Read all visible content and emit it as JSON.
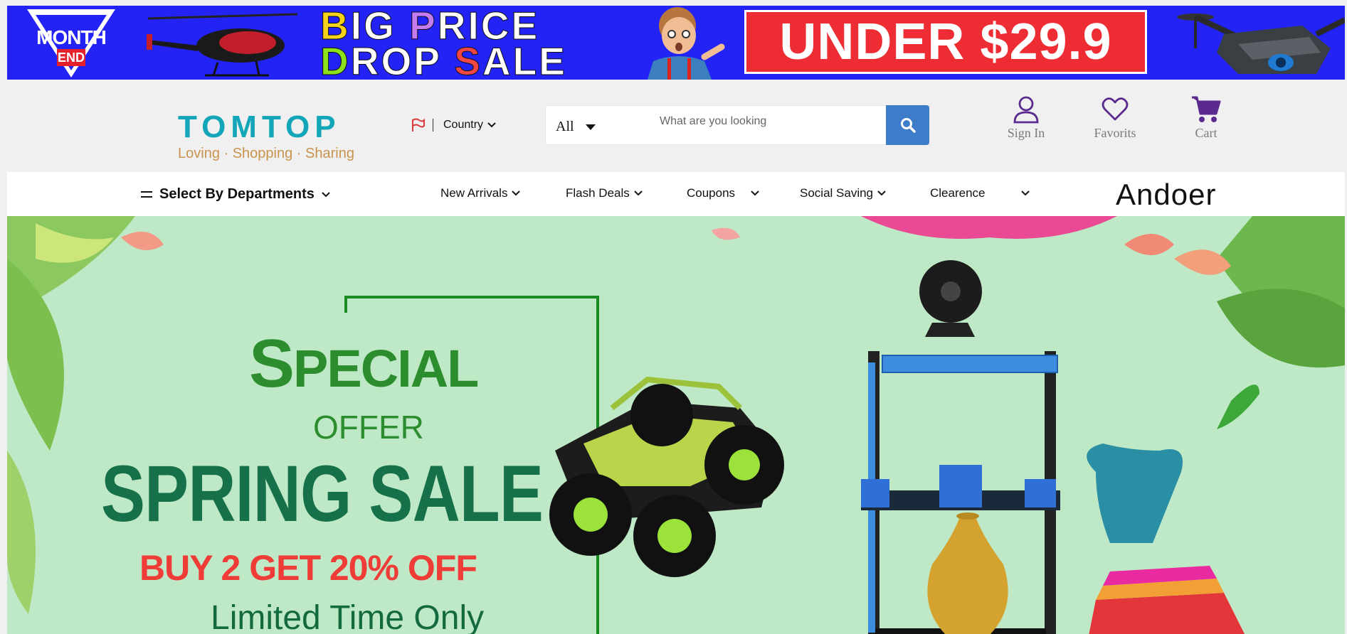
{
  "promo_banner": {
    "month_line1": "MONTH",
    "month_line2": "END",
    "headline_line1": [
      {
        "text": "B",
        "color": "#f7d21c"
      },
      {
        "text": "IG ",
        "color": "#ffffff"
      },
      {
        "text": "P",
        "color": "#c57cf2"
      },
      {
        "text": "RICE",
        "color": "#ffffff"
      }
    ],
    "headline_line2": [
      {
        "text": "D",
        "color": "#8be21a"
      },
      {
        "text": "ROP ",
        "color": "#ffffff"
      },
      {
        "text": "S",
        "color": "#f04646"
      },
      {
        "text": "ALE",
        "color": "#ffffff"
      }
    ],
    "offer": "UNDER $29.9",
    "background_color": "#2323f5"
  },
  "header": {
    "logo_name": "TOMTOP",
    "logo_tagline": "Loving · Shopping · Sharing",
    "country_label": "Country",
    "search": {
      "category": "All",
      "placeholder": "What are you looking"
    },
    "account": {
      "sign_in": "Sign In",
      "favorits": "Favorits",
      "cart": "Cart"
    }
  },
  "nav": {
    "departments": "Select By Departments",
    "links": [
      "New Arrivals",
      "Flash Deals",
      "Coupons",
      "Social Saving",
      "Clearence"
    ],
    "brand": "Andoer"
  },
  "hero": {
    "line1_big": "S",
    "line1_rest": "PECIAL",
    "line2": "OFFER",
    "line3": "SPRING SALE",
    "line4": "BUY 2 GET 20% OFF",
    "line5": "Limited Time Only",
    "accent_color": "#2c8d2e",
    "icons": [
      "flag-icon",
      "chevron-down-icon",
      "search-icon",
      "user-icon",
      "heart-icon",
      "cart-icon",
      "menu-icon"
    ]
  }
}
